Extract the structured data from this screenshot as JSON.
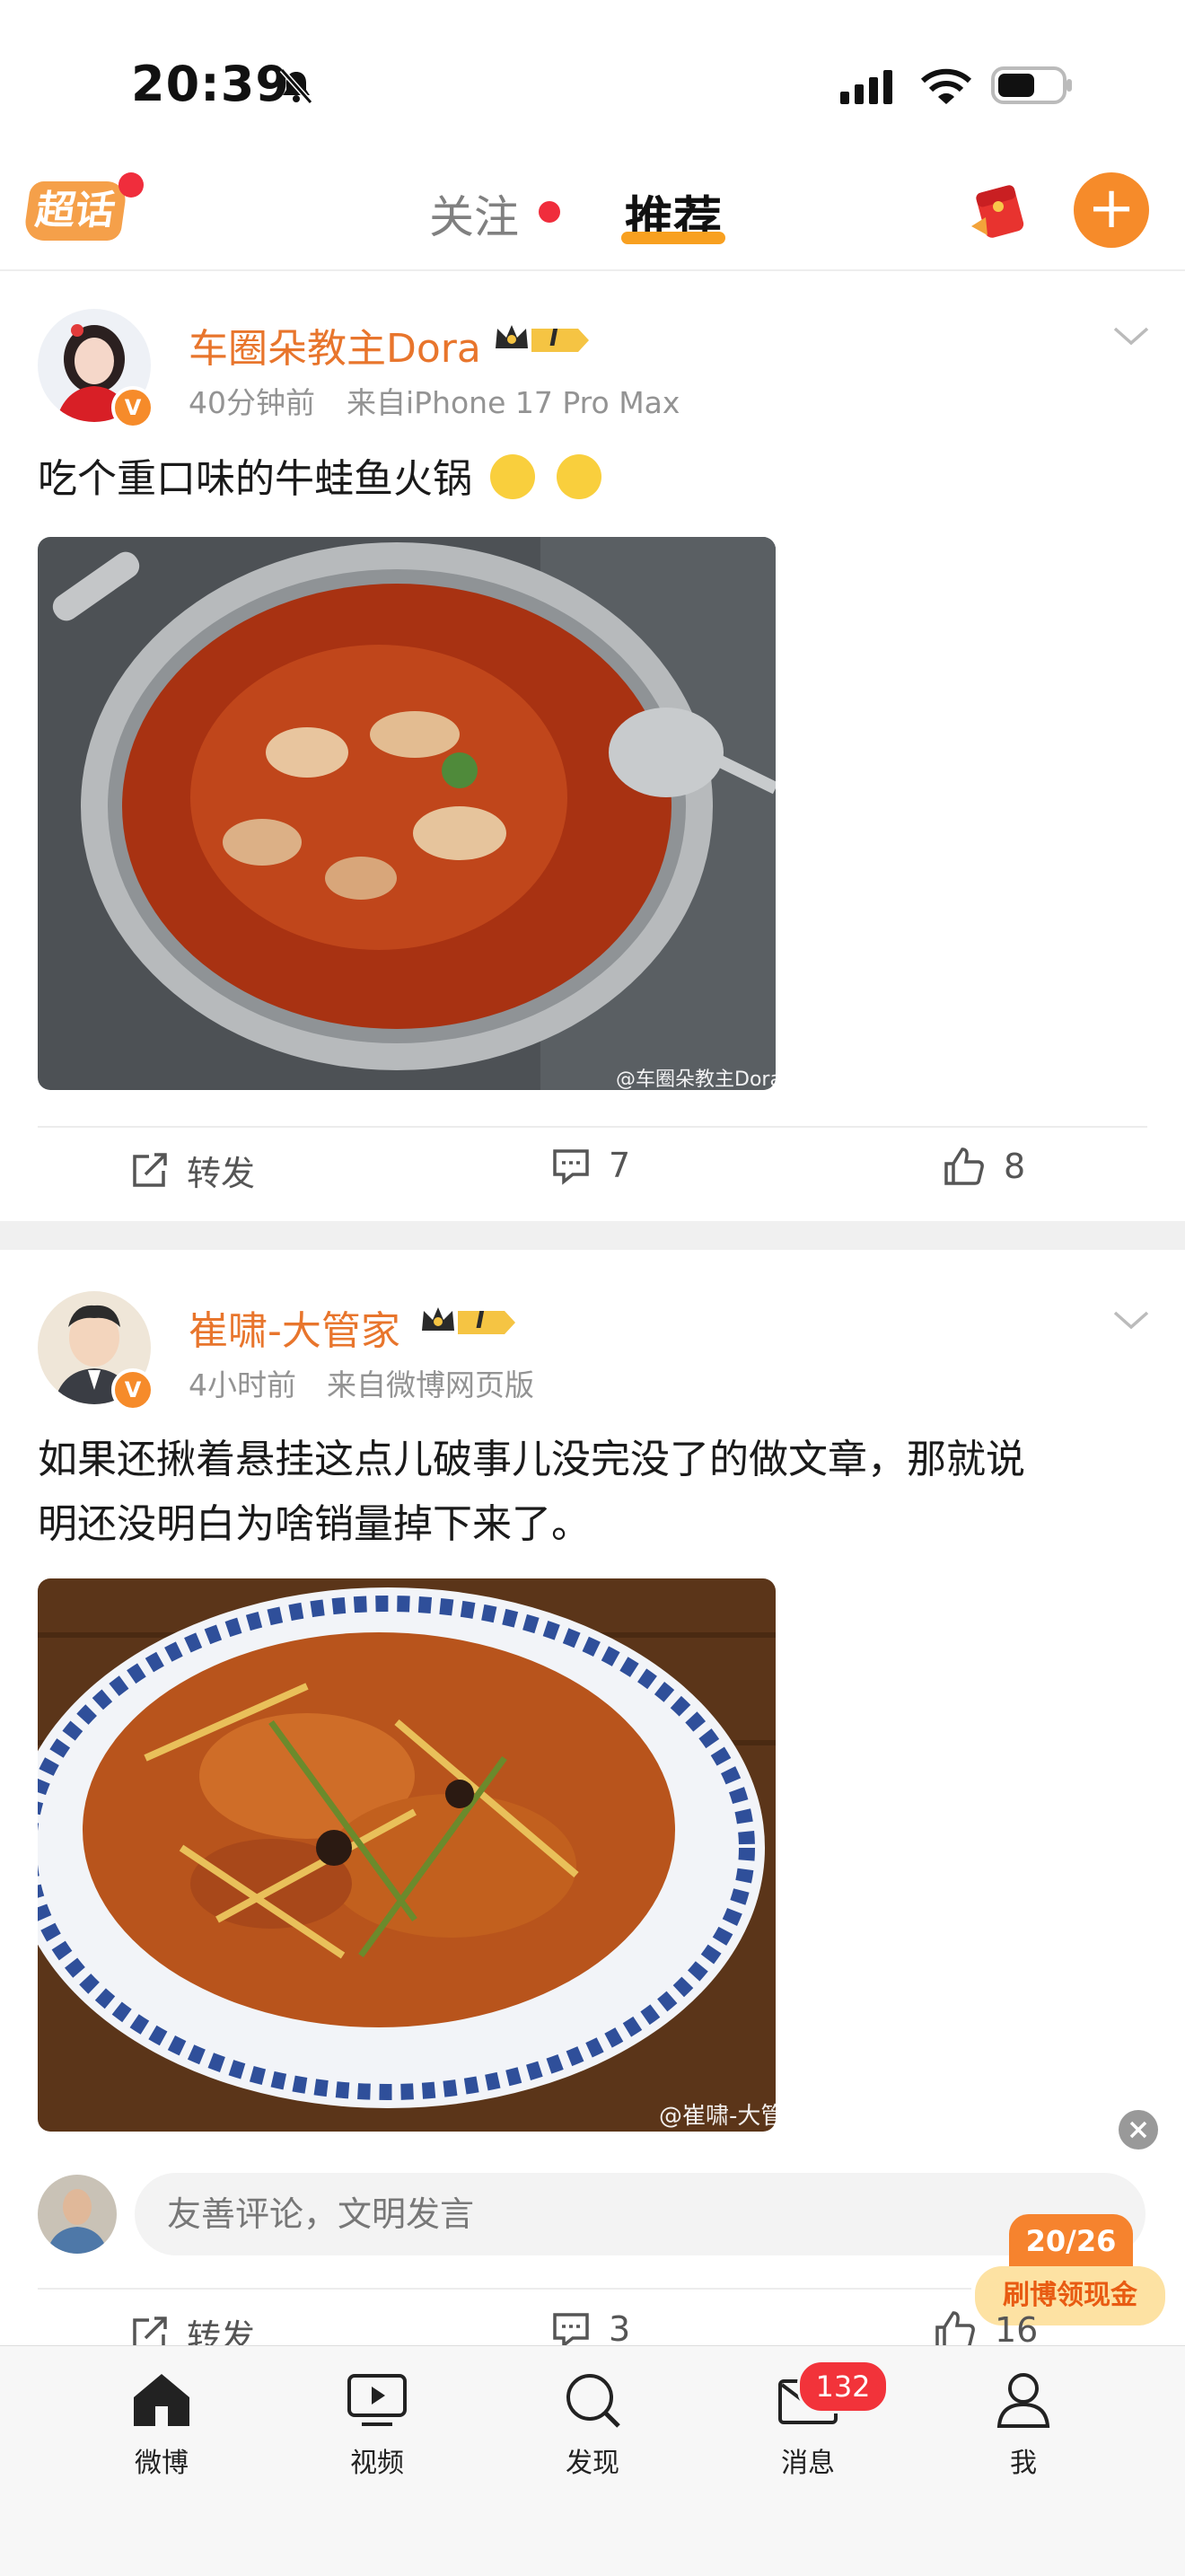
{
  "status_bar": {
    "time": "20:39"
  },
  "top_nav": {
    "chaohua_label": "超话",
    "tab_follow": "关注",
    "tab_recommend": "推荐"
  },
  "posts": [
    {
      "author": "车圈朵教主Dora",
      "level": "I",
      "time": "40分钟前",
      "source": "来自iPhone 17 Pro Max",
      "text": "吃个重口味的牛蛙鱼火锅",
      "watermark": "@车圈朵教主Dora",
      "repost_label": "转发",
      "comments": "7",
      "likes": "8"
    },
    {
      "author": "崔啸-大管家",
      "level": "I",
      "time": "4小时前",
      "source": "来自微博网页版",
      "text_line1": "如果还揪着悬挂这点儿破事儿没完没了的做文章，那就说",
      "text_line2": "明还没明白为啥销量掉下来了。",
      "watermark": "@崔啸-大管家",
      "repost_label": "转发",
      "comments": "3",
      "likes": "16"
    }
  ],
  "comment_box": {
    "placeholder": "友善评论，文明发言"
  },
  "promo": {
    "progress": "20/26",
    "label": "刷博领现金"
  },
  "tab_bar": {
    "items": [
      {
        "label": "微博"
      },
      {
        "label": "视频"
      },
      {
        "label": "发现"
      },
      {
        "label": "消息"
      },
      {
        "label": "我"
      }
    ],
    "message_badge": "132"
  },
  "colors": {
    "accent": "#f68b2a",
    "name": "#e8752c",
    "badge": "#f2333a"
  }
}
